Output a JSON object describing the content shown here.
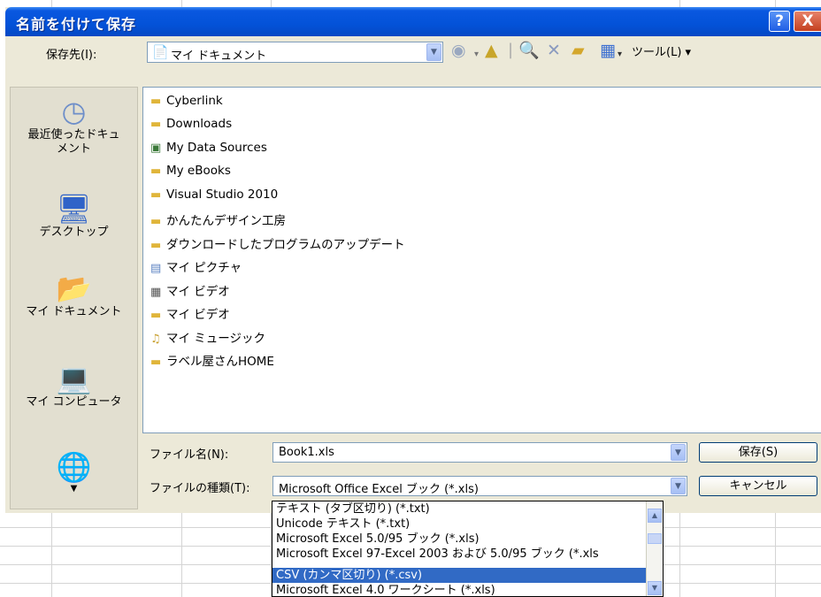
{
  "dialog": {
    "title": "名前を付けて保存",
    "help_button": "?",
    "close_button": "X"
  },
  "location": {
    "label": "保存先(I):",
    "value": "マイ ドキュメント"
  },
  "toolbar": {
    "tools_label": "ツール(L) ▾"
  },
  "places": [
    {
      "label": "最近使ったドキュメント",
      "icon": "recent-documents-icon"
    },
    {
      "label": "デスクトップ",
      "icon": "desktop-icon"
    },
    {
      "label": "マイ ドキュメント",
      "icon": "my-documents-icon"
    },
    {
      "label": "マイ コンピュータ",
      "icon": "my-computer-icon"
    },
    {
      "label": "",
      "icon": "network-places-icon"
    }
  ],
  "files": [
    {
      "name": "Cyberlink",
      "icon": "folder-icon"
    },
    {
      "name": "Downloads",
      "icon": "folder-icon"
    },
    {
      "name": "My Data Sources",
      "icon": "data-sources-folder-icon"
    },
    {
      "name": "My eBooks",
      "icon": "folder-icon"
    },
    {
      "name": "Visual Studio 2010",
      "icon": "folder-icon"
    },
    {
      "name": "かんたんデザイン工房",
      "icon": "folder-icon"
    },
    {
      "name": "ダウンロードしたプログラムのアップデート",
      "icon": "folder-icon"
    },
    {
      "name": "マイ ピクチャ",
      "icon": "pictures-folder-icon"
    },
    {
      "name": "マイ ビデオ",
      "icon": "video-folder-icon"
    },
    {
      "name": "マイ ビデオ",
      "icon": "folder-icon"
    },
    {
      "name": "マイ ミュージック",
      "icon": "music-folder-icon"
    },
    {
      "name": "ラベル屋さんHOME",
      "icon": "folder-icon"
    }
  ],
  "filename": {
    "label": "ファイル名(N):",
    "value": "Book1.xls"
  },
  "filetype": {
    "label": "ファイルの種類(T):",
    "value": "Microsoft Office Excel ブック (*.xls)"
  },
  "buttons": {
    "save": "保存(S)",
    "cancel": "キャンセル"
  },
  "type_options": [
    {
      "label": "テキスト (タブ区切り) (*.txt)",
      "selected": false
    },
    {
      "label": "Unicode テキスト (*.txt)",
      "selected": false
    },
    {
      "label": "Microsoft Excel 5.0/95 ブック (*.xls)",
      "selected": false
    },
    {
      "label": "Microsoft Excel 97-Excel 2003 および 5.0/95 ブック (*.xls",
      "selected": false
    },
    {
      "label": "CSV (カンマ区切り) (*.csv)",
      "selected": true
    },
    {
      "label": "Microsoft Excel 4.0 ワークシート (*.xls)",
      "selected": false
    }
  ]
}
